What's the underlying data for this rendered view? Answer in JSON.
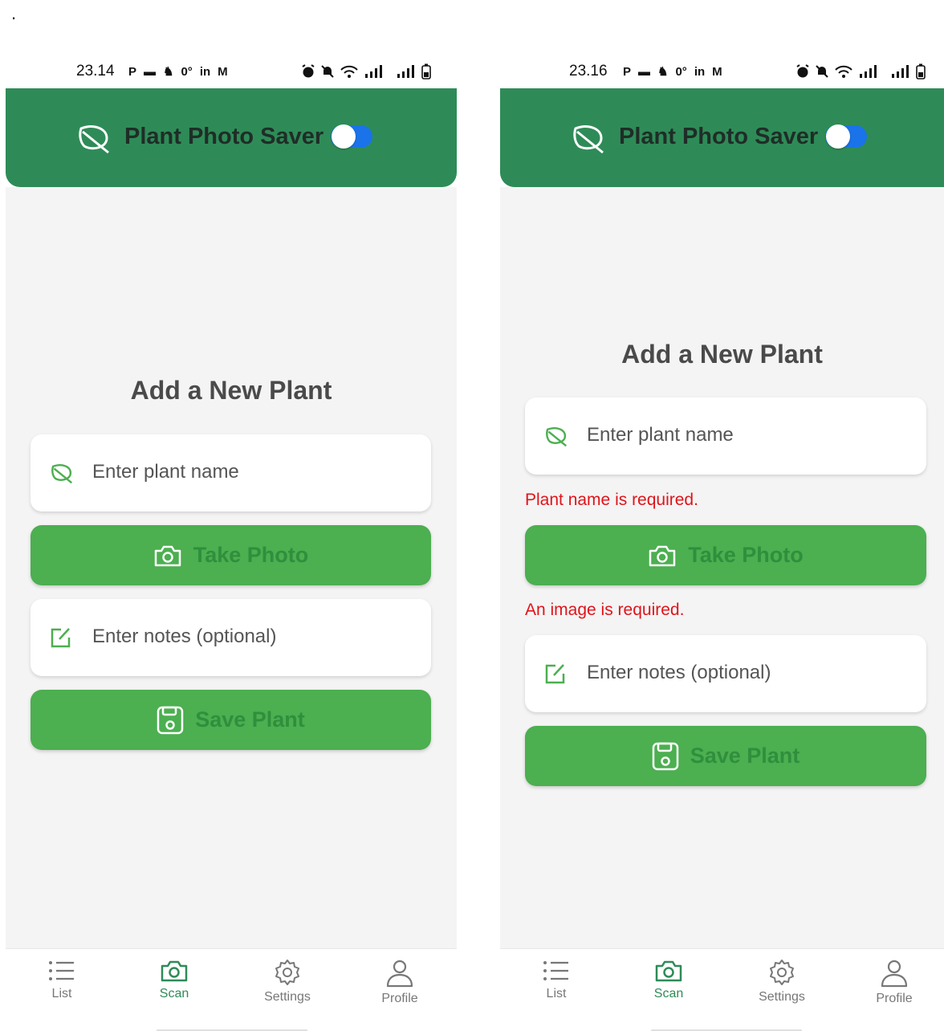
{
  "stray_mark": ".",
  "colors": {
    "header": "#2e8b57",
    "button": "#4caf50",
    "button_text": "#2f8f3d",
    "error": "#e0141a",
    "toggle": "#1a73e8",
    "background": "#f4f4f4"
  },
  "screens": [
    {
      "status": {
        "time": "23.14",
        "apps": [
          "P",
          "▬",
          "♞",
          "0°",
          "in",
          "M"
        ]
      },
      "header": {
        "title": "Plant Photo Saver",
        "icon": "leaf-icon",
        "toggle_on": true
      },
      "form": {
        "title": "Add a New Plant",
        "name_placeholder": "Enter plant name",
        "take_photo_label": "Take Photo",
        "notes_placeholder": "Enter notes (optional)",
        "save_label": "Save Plant"
      },
      "nav": [
        {
          "label": "List",
          "icon": "list-icon"
        },
        {
          "label": "Scan",
          "icon": "camera-icon",
          "active": true
        },
        {
          "label": "Settings",
          "icon": "gear-icon"
        },
        {
          "label": "Profile",
          "icon": "person-icon"
        }
      ]
    },
    {
      "status": {
        "time": "23.16",
        "apps": [
          "P",
          "▬",
          "♞",
          "0°",
          "in",
          "M"
        ]
      },
      "header": {
        "title": "Plant Photo Saver",
        "icon": "leaf-icon",
        "toggle_on": true
      },
      "form": {
        "title": "Add a New Plant",
        "name_placeholder": "Enter plant name",
        "name_error": "Plant name is required.",
        "take_photo_label": "Take Photo",
        "image_error": "An image is required.",
        "notes_placeholder": "Enter notes (optional)",
        "save_label": "Save Plant"
      },
      "nav": [
        {
          "label": "List",
          "icon": "list-icon"
        },
        {
          "label": "Scan",
          "icon": "camera-icon",
          "active": true
        },
        {
          "label": "Settings",
          "icon": "gear-icon"
        },
        {
          "label": "Profile",
          "icon": "person-icon"
        }
      ]
    }
  ]
}
